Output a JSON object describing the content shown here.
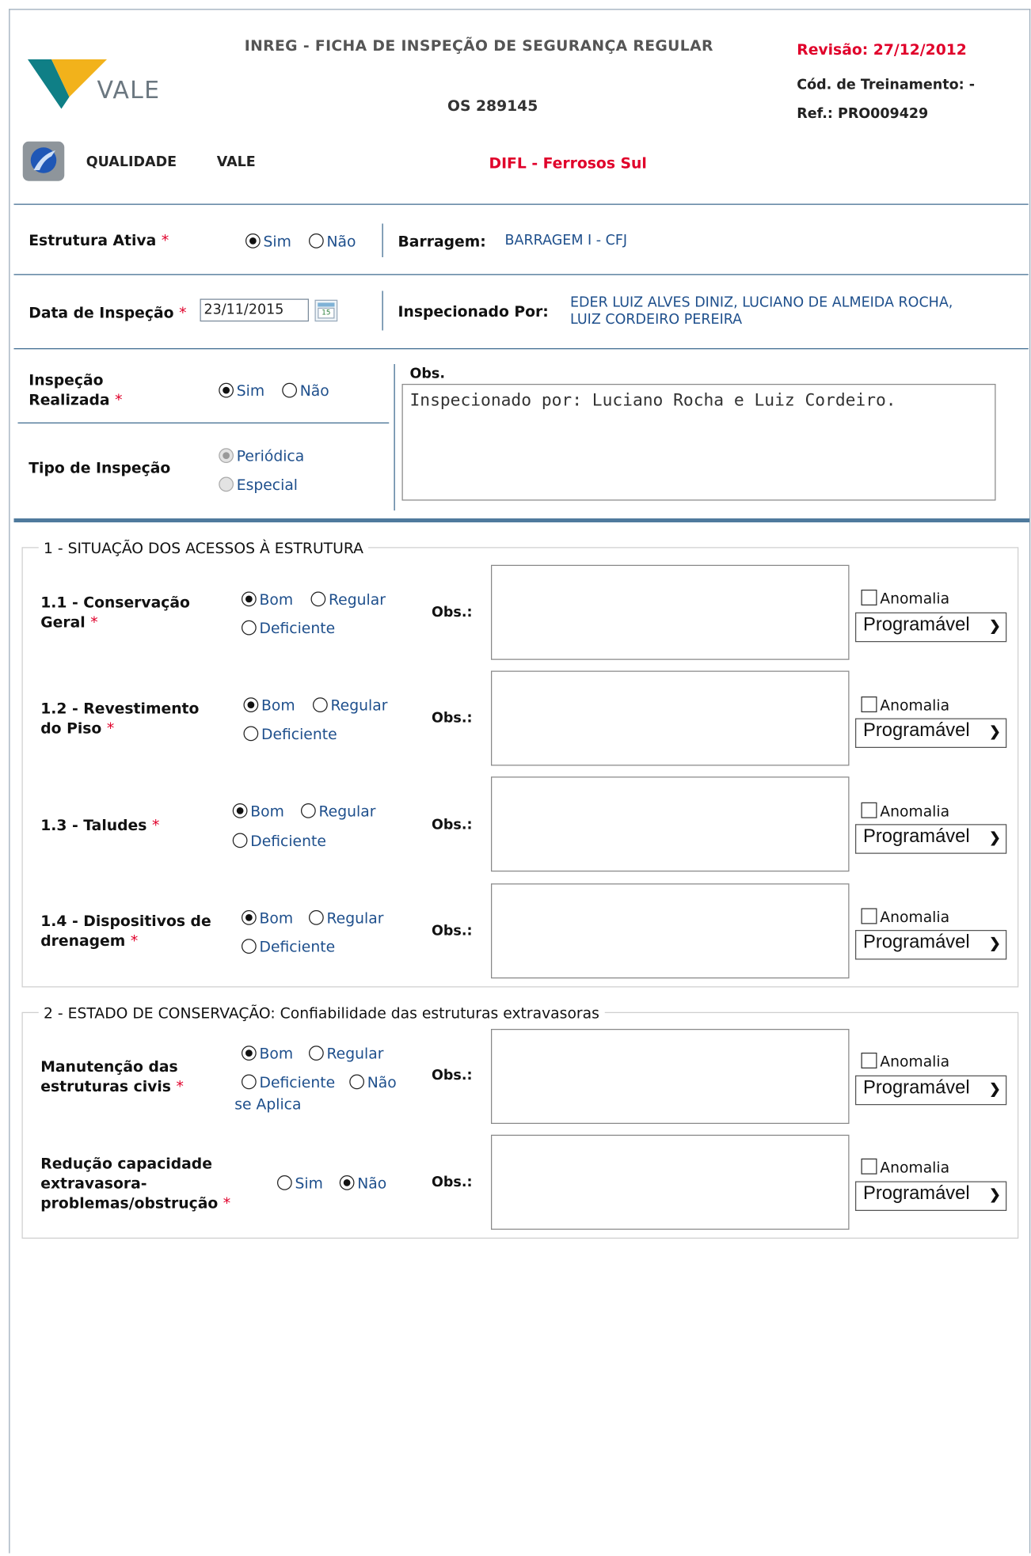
{
  "header": {
    "form_title": "INREG - FICHA DE INSPEÇÃO DE SEGURANÇA REGULAR",
    "os": "OS 289145",
    "revision": "Revisão: 27/12/2012",
    "training_code": "Cód. de Treinamento: -",
    "reference": "Ref.: PRO009429",
    "logo_text": "VALE",
    "quality_label": "QUALIDADE",
    "vale_label": "VALE",
    "unit": "DIFL - Ferrosos Sul",
    "accent_color": "#e0002a"
  },
  "general": {
    "estrutura_ativa": {
      "label": "Estrutura Ativa",
      "options": [
        "Sim",
        "Não"
      ],
      "selected": "Sim"
    },
    "barragem": {
      "label": "Barragem:",
      "value": "BARRAGEM I - CFJ"
    },
    "data_inspecao": {
      "label": "Data de Inspeção",
      "value": "23/11/2015",
      "calendar_icon_text": "15"
    },
    "inspecionado_por": {
      "label": "Inspecionado Por:",
      "line1": "EDER LUIZ ALVES DINIZ, LUCIANO DE ALMEIDA ROCHA,",
      "line2": "LUIZ CORDEIRO PEREIRA"
    },
    "inspecao_realizada": {
      "label_line1": "Inspeção",
      "label_line2": "Realizada",
      "options": [
        "Sim",
        "Não"
      ],
      "selected": "Sim"
    },
    "tipo_inspecao": {
      "label": "Tipo de Inspeção",
      "options": [
        "Periódica",
        "Especial"
      ],
      "selected": "Periódica"
    },
    "obs": {
      "label": "Obs.",
      "value": "Inspecionado por: Luciano Rocha e Luiz Cordeiro."
    }
  },
  "sections": [
    {
      "legend": "1 - SITUAÇÃO DOS ACESSOS À ESTRUTURA",
      "items": [
        {
          "label_line1": "1.1 - Conservação",
          "label_line2": "Geral",
          "options": [
            "Bom",
            "Regular",
            "Deficiente"
          ],
          "selected": "Bom"
        },
        {
          "label_line1": "1.2 - Revestimento",
          "label_line2": "do Piso",
          "options": [
            "Bom",
            "Regular",
            "Deficiente"
          ],
          "selected": "Bom"
        },
        {
          "label_line1": "1.3 - Taludes",
          "label_line2": "",
          "options": [
            "Bom",
            "Regular",
            "Deficiente"
          ],
          "selected": "Bom"
        },
        {
          "label_line1": "1.4 - Dispositivos de",
          "label_line2": "drenagem",
          "options": [
            "Bom",
            "Regular",
            "Deficiente"
          ],
          "selected": "Bom"
        }
      ]
    },
    {
      "legend": "2 - ESTADO DE CONSERVAÇÃO: Confiabilidade das estruturas extravasoras",
      "items": [
        {
          "label_line1": "Manutenção das",
          "label_line2": "estruturas civis",
          "options": [
            "Bom",
            "Regular",
            "Deficiente",
            "Não",
            "se Aplica"
          ],
          "selected": "Bom"
        },
        {
          "label_line1": "Redução capacidade",
          "label_line2": "extravasora-",
          "label_line3": "problemas/obstrução",
          "options": [
            "Sim",
            "Não"
          ],
          "selected": "Não"
        }
      ]
    }
  ],
  "common": {
    "obs_label": "Obs.:",
    "anomalia_label": "Anomalia",
    "select_value": "Programável",
    "required_mark": "*"
  }
}
